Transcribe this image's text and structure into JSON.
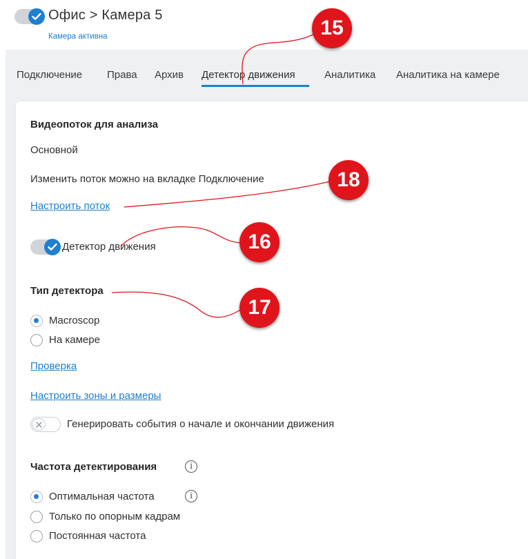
{
  "header": {
    "title": "Офис > Камера 5",
    "status": "Камера активна"
  },
  "tabs": [
    {
      "label": "Подключение"
    },
    {
      "label": "Права"
    },
    {
      "label": "Архив"
    },
    {
      "label": "Детектор движения",
      "active": true
    },
    {
      "label": "Аналитика"
    },
    {
      "label": "Аналитика на камере"
    }
  ],
  "motion": {
    "stream_heading": "Видеопоток для анализа",
    "stream_value": "Основной",
    "stream_hint": "Изменить поток можно на вкладке Подключение",
    "configure_stream_link": "Настроить поток",
    "detector_toggle_label": "Детектор движения",
    "detector_enabled": true,
    "detector_type_heading": "Тип детектора",
    "detector_types": [
      {
        "label": "Macroscop",
        "checked": true
      },
      {
        "label": "На камере",
        "checked": false
      }
    ],
    "check_link": "Проверка",
    "zones_link": "Настроить зоны и размеры",
    "events_toggle_label": "Генерировать события о начале и окончании движения",
    "events_enabled": false,
    "frequency_heading": "Частота детектирования",
    "frequency_options": [
      {
        "label": "Оптимальная частота",
        "checked": true
      },
      {
        "label": "Только по опорным кадрам",
        "checked": false
      },
      {
        "label": "Постоянная частота",
        "checked": false
      }
    ]
  },
  "annotations": {
    "c15": "15",
    "c16": "16",
    "c17": "17",
    "c18": "18"
  },
  "colors": {
    "accent": "#1e7fc8",
    "callout": "#e0141b"
  },
  "icons": {
    "check": "check-icon",
    "cross": "x-icon",
    "info": "info-icon"
  }
}
